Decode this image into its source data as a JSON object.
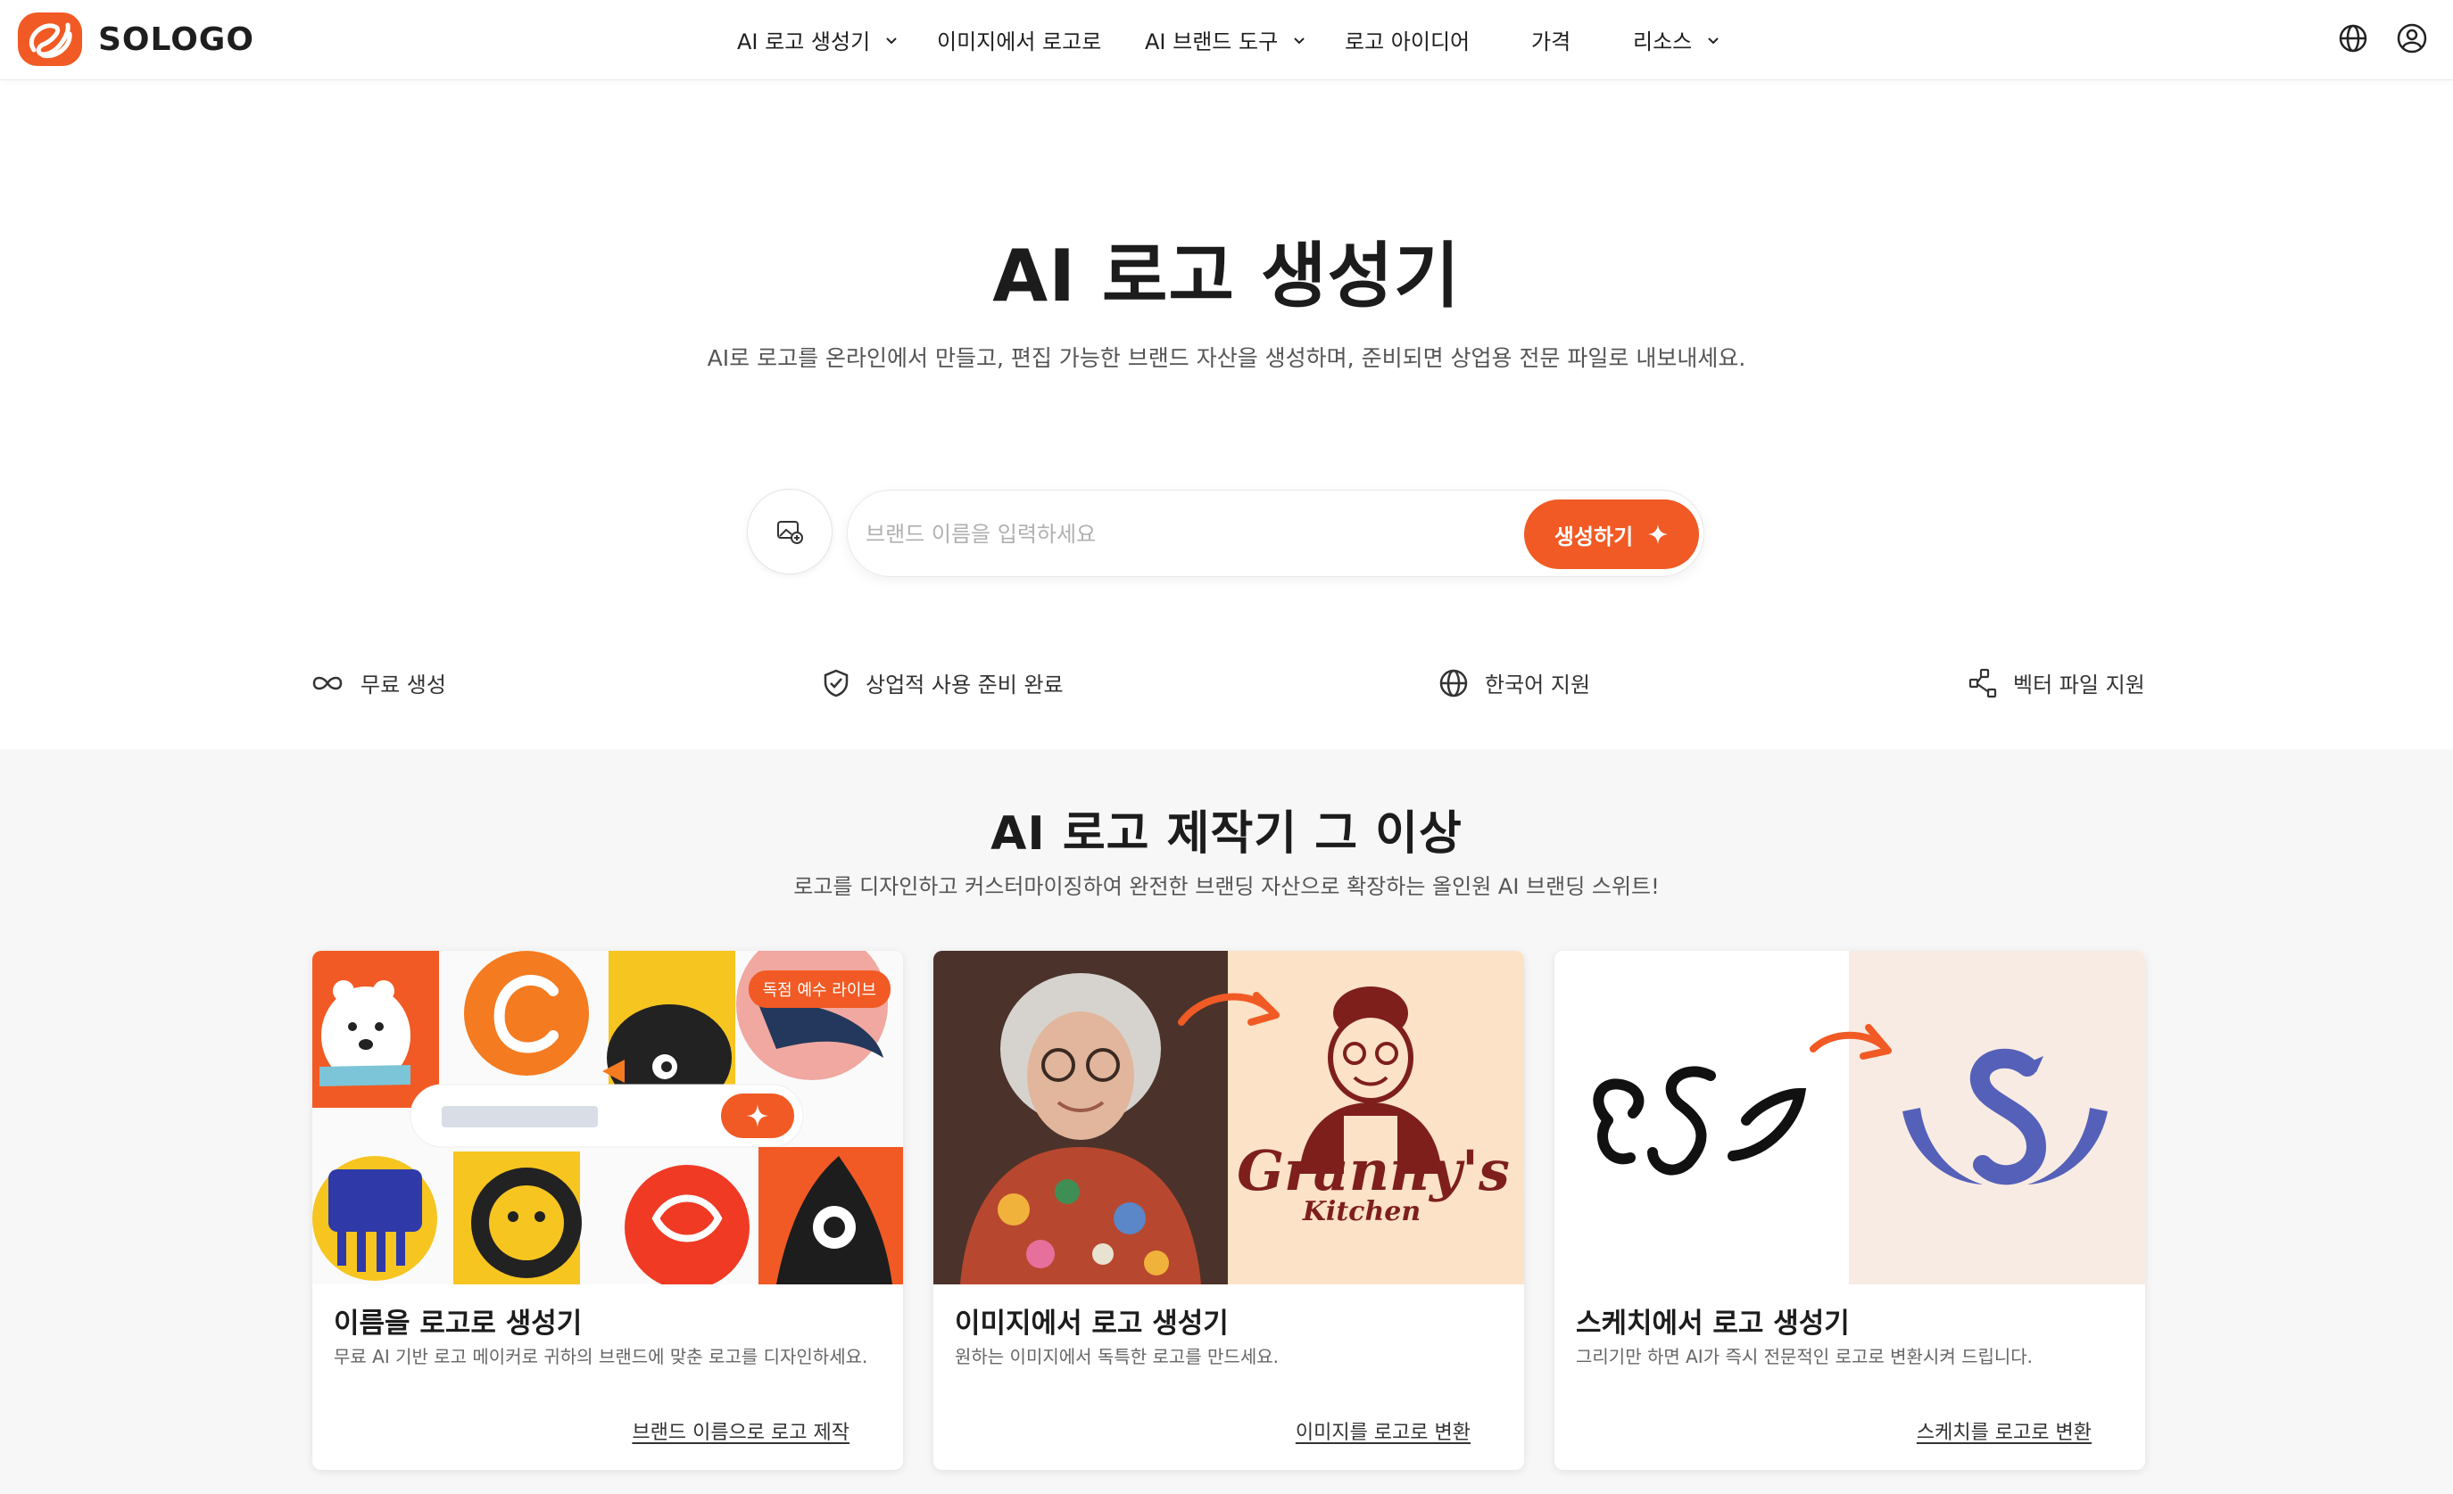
{
  "header": {
    "brand": "SOLOGO",
    "nav": [
      {
        "label": "AI 로고 생성기",
        "dropdown": true
      },
      {
        "label": "이미지에서 로고로",
        "dropdown": false
      },
      {
        "label": "AI 브랜드 도구",
        "dropdown": true
      },
      {
        "label": "로고 아이디어",
        "dropdown": false
      },
      {
        "label": "가격",
        "dropdown": false
      },
      {
        "label": "리소스",
        "dropdown": true
      }
    ],
    "icons": [
      "globe-icon",
      "user-icon"
    ]
  },
  "hero": {
    "title": "AI 로고 생성기",
    "subtitle": "AI로 로고를 온라인에서 만들고, 편집 가능한 브랜드 자산을 생성하며, 준비되면 상업용 전문 파일로 내보내세요.",
    "search_placeholder": "브랜드 이름을 입력하세요",
    "search_value": "",
    "generate_label": "생성하기"
  },
  "features": [
    {
      "label": "무료 생성",
      "icon": "infinity-icon"
    },
    {
      "label": "상업적 사용 준비 완료",
      "icon": "shield-check-icon"
    },
    {
      "label": "한국어 지원",
      "icon": "globe-icon"
    },
    {
      "label": "벡터 파일 지원",
      "icon": "vector-share-icon"
    }
  ],
  "section": {
    "title": "AI 로고 제작기 그 이상",
    "subtitle": "로고를 디자인하고 커스터마이징하여 완전한 브랜딩 자산으로 확장하는 올인원 AI 브랜딩 스위트!"
  },
  "cards": [
    {
      "title": "이름을 로고로 생성기",
      "desc": "무료 AI 기반 로고 메이커로 귀하의 브랜드에 맞춘 로고를 디자인하세요.",
      "link": "브랜드 이름으로 로고 제작",
      "badge": "독점 예수 라이브"
    },
    {
      "title": "이미지에서 로고 생성기",
      "desc": "원하는 이미지에서 독특한 로고를 만드세요.",
      "link": "이미지를 로고로 변환",
      "logo_text_1": "Granny's",
      "logo_text_2": "Kitchen"
    },
    {
      "title": "스케치에서 로고 생성기",
      "desc": "그리기만 하면 AI가 즉시 전문적인 로고로 변환시켜 드립니다.",
      "link": "스케치를 로고로 변환"
    }
  ],
  "colors": {
    "accent": "#f15a24",
    "section_bg": "#f7f7f7",
    "text": "#1c1c1c"
  }
}
